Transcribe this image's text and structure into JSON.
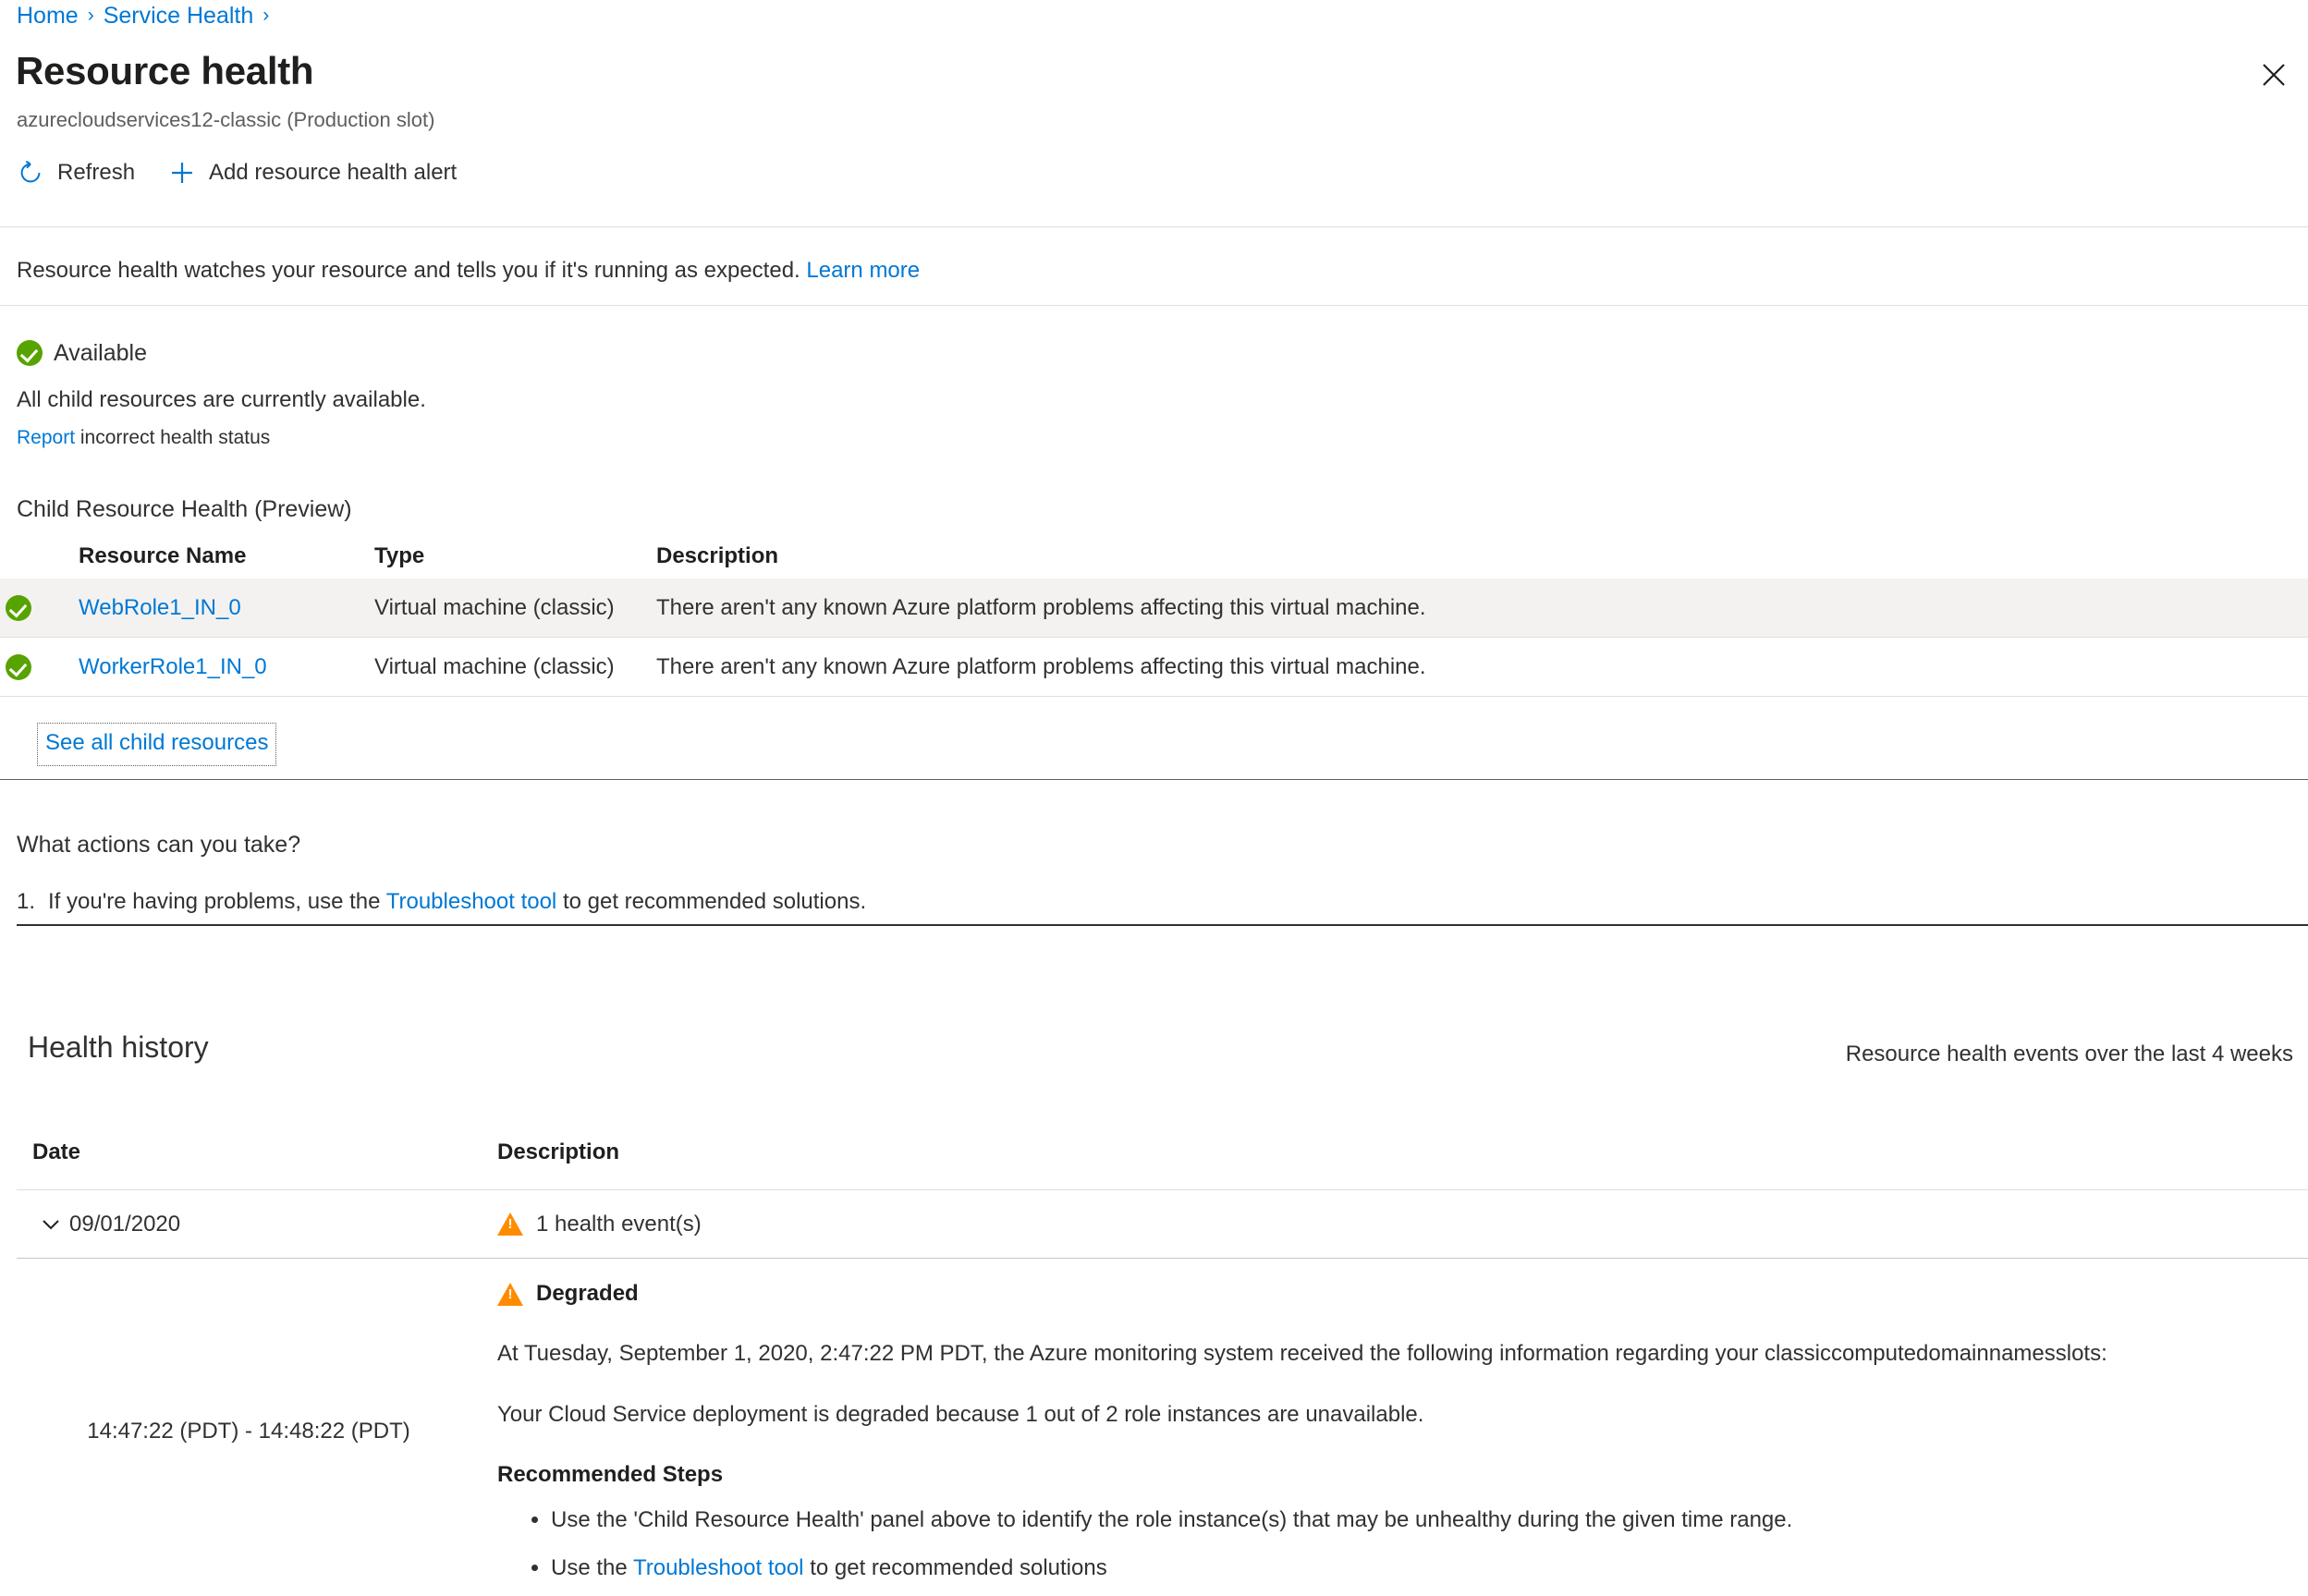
{
  "breadcrumb": {
    "items": [
      {
        "label": "Home"
      },
      {
        "label": "Service Health"
      }
    ],
    "separator": "›"
  },
  "header": {
    "title": "Resource health",
    "subtitle": "azurecloudservices12-classic (Production slot)",
    "close_icon": "close-icon"
  },
  "toolbar": {
    "refresh_label": "Refresh",
    "refresh_icon": "refresh-icon",
    "add_alert_label": "Add resource health alert",
    "add_alert_icon": "plus-icon"
  },
  "intro": {
    "text": "Resource health watches your resource and tells you if it's running as expected.",
    "link_label": "Learn more"
  },
  "status": {
    "icon": "success-check-icon",
    "label": "Available",
    "description": "All child resources are currently available.",
    "report_link": "Report",
    "report_rest": "incorrect health status"
  },
  "child_resource_health": {
    "section_title": "Child Resource Health (Preview)",
    "columns": [
      "Resource Name",
      "Type",
      "Description"
    ],
    "rows": [
      {
        "status_icon": "success-check-icon",
        "name": "WebRole1_IN_0",
        "type": "Virtual machine (classic)",
        "description": "There aren't any known Azure platform problems affecting this virtual machine."
      },
      {
        "status_icon": "success-check-icon",
        "name": "WorkerRole1_IN_0",
        "type": "Virtual machine (classic)",
        "description": "There aren't any known Azure platform problems affecting this virtual machine."
      }
    ],
    "see_all_label": "See all child resources"
  },
  "actions": {
    "title": "What actions can you take?",
    "item_number": "1.",
    "item_prefix": "If you're having problems, use the",
    "item_link": "Troubleshoot tool",
    "item_suffix": "to get recommended solutions."
  },
  "health_history": {
    "title": "Health history",
    "note": "Resource health events over the last 4 weeks",
    "columns": [
      "Date",
      "Description"
    ],
    "rows": [
      {
        "chevron_icon": "chevron-down-icon",
        "date": "09/01/2020",
        "event_icon": "warning-icon",
        "event_summary": "1 health event(s)",
        "expanded": {
          "time_range": "14:47:22 (PDT) - 14:48:22 (PDT)",
          "status_icon": "warning-icon",
          "status_label": "Degraded",
          "paragraph_1": "At Tuesday, September 1, 2020, 2:47:22 PM PDT, the Azure monitoring system received the following information regarding your classiccomputedomainnamesslots:",
          "paragraph_2": "Your Cloud Service deployment is degraded because 1 out of 2 role instances are unavailable.",
          "recommended_title": "Recommended Steps",
          "recommended_steps": [
            {
              "prefix": "Use the 'Child Resource Health' panel above to identify the role instance(s) that may be unhealthy during the given time range.",
              "link": "",
              "suffix": ""
            },
            {
              "prefix": "Use the",
              "link": "Troubleshoot tool",
              "suffix": "to get recommended solutions"
            }
          ]
        }
      }
    ]
  },
  "colors": {
    "link": "#0078d4",
    "success": "#57a300",
    "warning": "#ff8c00",
    "text": "#323130",
    "row_alt": "#f3f2f1",
    "divider": "#e1dfdd"
  }
}
